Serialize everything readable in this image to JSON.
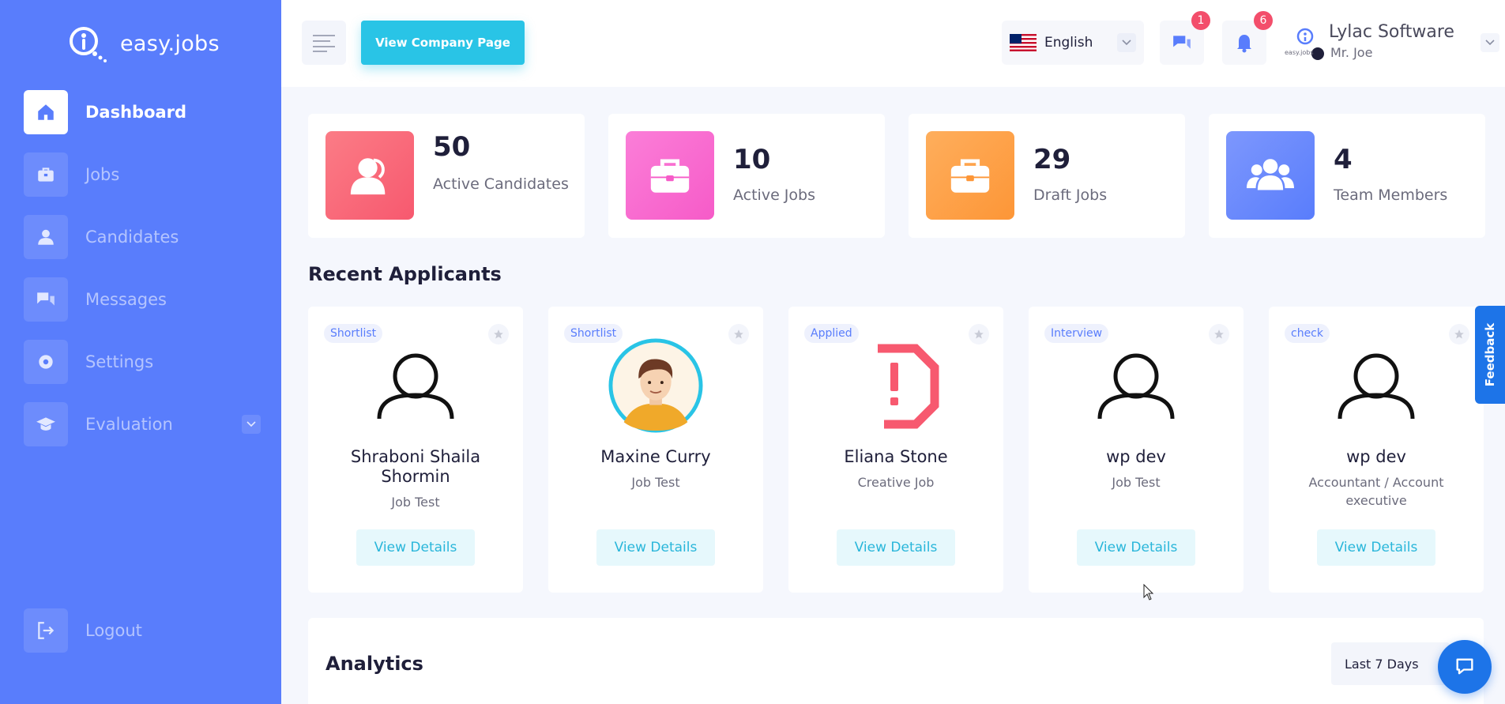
{
  "brand": {
    "name": "easy.jobs"
  },
  "sidebar": {
    "items": [
      {
        "label": "Dashboard",
        "icon": "home-icon",
        "active": true
      },
      {
        "label": "Jobs",
        "icon": "briefcase-icon"
      },
      {
        "label": "Candidates",
        "icon": "user-icon"
      },
      {
        "label": "Messages",
        "icon": "chat-icon"
      },
      {
        "label": "Settings",
        "icon": "gear-icon"
      },
      {
        "label": "Evaluation",
        "icon": "graduation-cap-icon",
        "expandable": true
      }
    ],
    "logout_label": "Logout"
  },
  "topbar": {
    "company_page_label": "View Company Page",
    "language": "English",
    "messages_badge": "1",
    "notifications_badge": "6",
    "company_name": "Lylac Software",
    "user_name": "Mr. Joe",
    "avatar_caption": "easy.jobs"
  },
  "stats": [
    {
      "value": "50",
      "label": "Active Candidates",
      "color": "#f7596f"
    },
    {
      "value": "10",
      "label": "Active Jobs",
      "color": "#f65bc8"
    },
    {
      "value": "29",
      "label": "Draft Jobs",
      "color": "#fd9637"
    },
    {
      "value": "4",
      "label": "Team Members",
      "color": "#597dfc"
    }
  ],
  "recent_applicants": {
    "title": "Recent Applicants",
    "cards": [
      {
        "status": "Shortlist",
        "name": "Shraboni Shaila Shormin",
        "job": "Job Test",
        "button": "View Details"
      },
      {
        "status": "Shortlist",
        "name": "Maxine Curry",
        "job": "Job Test",
        "button": "View Details"
      },
      {
        "status": "Applied",
        "name": "Eliana Stone",
        "job": "Creative Job",
        "button": "View Details"
      },
      {
        "status": "Interview",
        "name": "wp dev",
        "job": "Job Test",
        "button": "View Details"
      },
      {
        "status": "check",
        "name": "wp dev",
        "job": "Accountant / Account executive",
        "button": "View Details"
      }
    ]
  },
  "analytics": {
    "title": "Analytics",
    "range": "Last 7 Days"
  },
  "feedback_label": "Feedback",
  "colors": {
    "sidebar": "#597dfc",
    "accent": "#29c4e6",
    "badge": "#f34e6b",
    "feedback": "#1d74e8"
  }
}
